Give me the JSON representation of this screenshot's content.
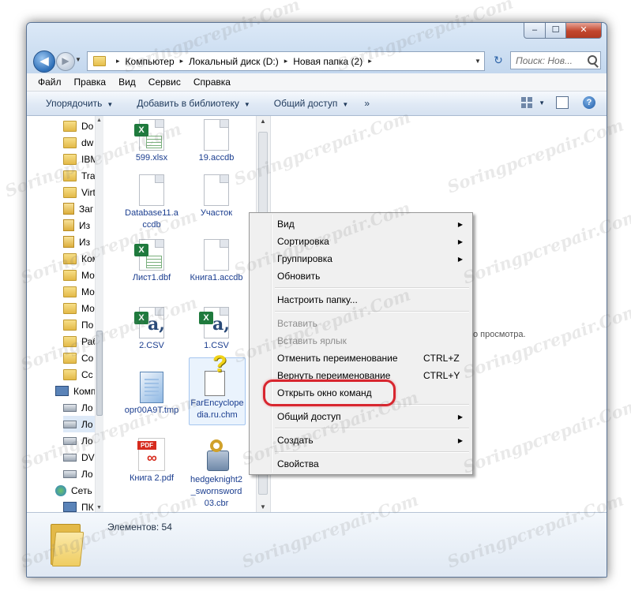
{
  "window": {
    "min_label": "–",
    "max_label": "☐",
    "close_label": "✕"
  },
  "address": {
    "segments": [
      "Компьютер",
      "Локальный диск (D:)",
      "Новая папка (2)"
    ],
    "separator": "▸"
  },
  "search": {
    "placeholder": "Поиск: Нов..."
  },
  "menubar": [
    "Файл",
    "Правка",
    "Вид",
    "Сервис",
    "Справка"
  ],
  "toolbar": {
    "organize": "Упорядочить",
    "add_library": "Добавить в библиотеку",
    "share": "Общий доступ",
    "more": "»",
    "help": "?"
  },
  "nav_items": [
    {
      "label": "Do",
      "icon": "folder-icon"
    },
    {
      "label": "dw",
      "icon": "folder-icon"
    },
    {
      "label": "IBM",
      "icon": "folder-icon"
    },
    {
      "label": "Tra",
      "icon": "folder-icon"
    },
    {
      "label": "Virt",
      "icon": "folder-icon"
    },
    {
      "label": "Заг",
      "icon": "library-icon"
    },
    {
      "label": "Из",
      "icon": "library-icon"
    },
    {
      "label": "Из",
      "icon": "library-icon"
    },
    {
      "label": "Ком",
      "icon": "folder-icon"
    },
    {
      "label": "Мо",
      "icon": "folder-icon"
    },
    {
      "label": "Мо",
      "icon": "folder-icon"
    },
    {
      "label": "Мо",
      "icon": "folder-icon"
    },
    {
      "label": "По",
      "icon": "folder-icon"
    },
    {
      "label": "Раб",
      "icon": "folder-icon"
    },
    {
      "label": "Co",
      "icon": "folder-icon"
    },
    {
      "label": "Сс",
      "icon": "folder-icon"
    },
    {
      "label": "Комп",
      "icon": "computer-icon"
    },
    {
      "label": "Ло",
      "icon": "drive-icon"
    },
    {
      "label": "Ло",
      "icon": "drive-icon"
    },
    {
      "label": "Ло",
      "icon": "drive-icon"
    },
    {
      "label": "DV",
      "icon": "drive-icon"
    },
    {
      "label": "Ло",
      "icon": "drive-icon"
    },
    {
      "label": "Сеть",
      "icon": "network-icon"
    },
    {
      "label": "ПК",
      "icon": "computer-icon"
    }
  ],
  "files": [
    {
      "label": "599.xlsx",
      "icon": "excel-file-icon"
    },
    {
      "label": "19.accdb",
      "icon": "blank-file-icon"
    },
    {
      "label": "Database11.accdb",
      "icon": "blank-file-icon"
    },
    {
      "label": "Участок",
      "icon": "blank-file-icon"
    },
    {
      "label": "Лист1.dbf",
      "icon": "excel-file-icon"
    },
    {
      "label": "Книга1.accdb",
      "icon": "blank-file-icon"
    },
    {
      "label": "2.CSV",
      "icon": "excel-csv-icon"
    },
    {
      "label": "1.CSV",
      "icon": "excel-csv-icon"
    },
    {
      "label": "opr00A9T.tmp",
      "icon": "tmp-file-icon"
    },
    {
      "label": "FarEncyclopedia.ru.chm",
      "icon": "chm-help-icon"
    },
    {
      "label": "Книга 2.pdf",
      "icon": "pdf-file-icon"
    },
    {
      "label": "hedgeknight2_swornsword03.cbr",
      "icon": "archive-file-icon"
    }
  ],
  "preview_text": "ного просмотра.",
  "status": {
    "items_count": "Элементов: 54"
  },
  "context_menu": [
    {
      "label": "Вид",
      "arrow": "▶",
      "disabled": false
    },
    {
      "label": "Сортировка",
      "arrow": "▶",
      "disabled": false
    },
    {
      "label": "Группировка",
      "arrow": "▶",
      "disabled": false
    },
    {
      "label": "Обновить",
      "disabled": false
    },
    {
      "label": "Настроить папку...",
      "disabled": false
    },
    {
      "label": "Вставить",
      "disabled": true
    },
    {
      "label": "Вставить ярлык",
      "disabled": true
    },
    {
      "label": "Отменить переименование",
      "shortcut": "CTRL+Z",
      "disabled": false
    },
    {
      "label": "Вернуть переименование",
      "shortcut": "CTRL+Y",
      "disabled": false
    },
    {
      "label": "Открыть окно команд",
      "disabled": false
    },
    {
      "label": "Общий доступ",
      "arrow": "▶",
      "disabled": false
    },
    {
      "label": "Создать",
      "arrow": "▶",
      "disabled": false
    },
    {
      "label": "Свойства",
      "disabled": false
    }
  ],
  "watermark": "Soringpcrepair.Com",
  "colors": {
    "highlight": "#d8262f",
    "accent": "#1e395b"
  }
}
